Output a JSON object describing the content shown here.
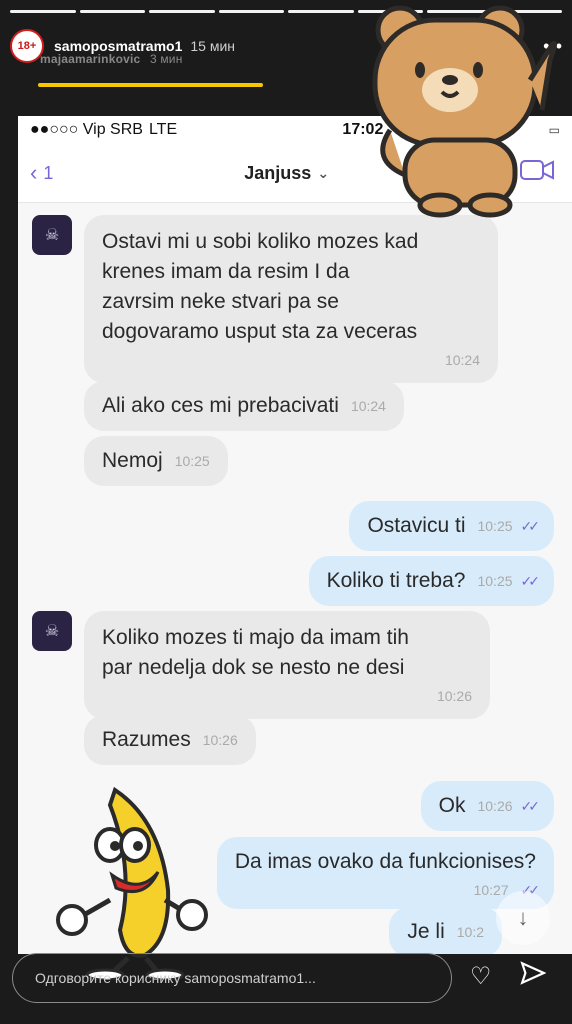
{
  "story": {
    "username": "samoposmatramo1",
    "posted_time": "15 мин",
    "avatar_label": "18+",
    "tagged_user": "majaamarinkovic",
    "tagged_time": "3 мин"
  },
  "header_icons": [
    "play-icon",
    "volume-icon",
    "more-icon"
  ],
  "screenshot": {
    "status": {
      "carrier": "●●○○○ Vip SRB",
      "network": "LTE",
      "time": "17:02"
    },
    "nav": {
      "back_count": "1",
      "title": "Janjuss",
      "title_chevron": "⌄"
    },
    "messages": [
      {
        "side": "in",
        "text_lines": [
          "Ostavi mi u sobi koliko mozes kad",
          "krenes imam da resim I da",
          "zavrsim neke stvari pa se",
          "dogovaramo usput sta za veceras"
        ],
        "time": "10:24"
      },
      {
        "side": "in",
        "text": "Ali ako ces mi prebacivati",
        "time": "10:24"
      },
      {
        "side": "in",
        "text": "Nemoj",
        "time": "10:25"
      },
      {
        "side": "out",
        "text": "Ostavicu ti",
        "time": "10:25"
      },
      {
        "side": "out",
        "text": "Koliko ti treba?",
        "time": "10:25"
      },
      {
        "side": "in",
        "text_lines": [
          "Koliko mozes ti majo da imam tih",
          "par nedelja dok se nesto ne desi"
        ],
        "time": "10:26"
      },
      {
        "side": "in",
        "text": "Razumes",
        "time": "10:26"
      },
      {
        "side": "out",
        "text": "Ok",
        "time": "10:26"
      },
      {
        "side": "out",
        "text": "Da imas ovako da funkcionises?",
        "time": "10:27"
      },
      {
        "side": "out",
        "text": "Je li",
        "time": "10:2"
      }
    ]
  },
  "reply": {
    "placeholder": "Одговорите кориснику samoposmatramo1..."
  },
  "colors": {
    "accent": "#7a65d6",
    "incoming_bubble": "#e9e9ea",
    "outgoing_bubble": "#d8ebfa",
    "progress_yellow": "#f7c600"
  }
}
